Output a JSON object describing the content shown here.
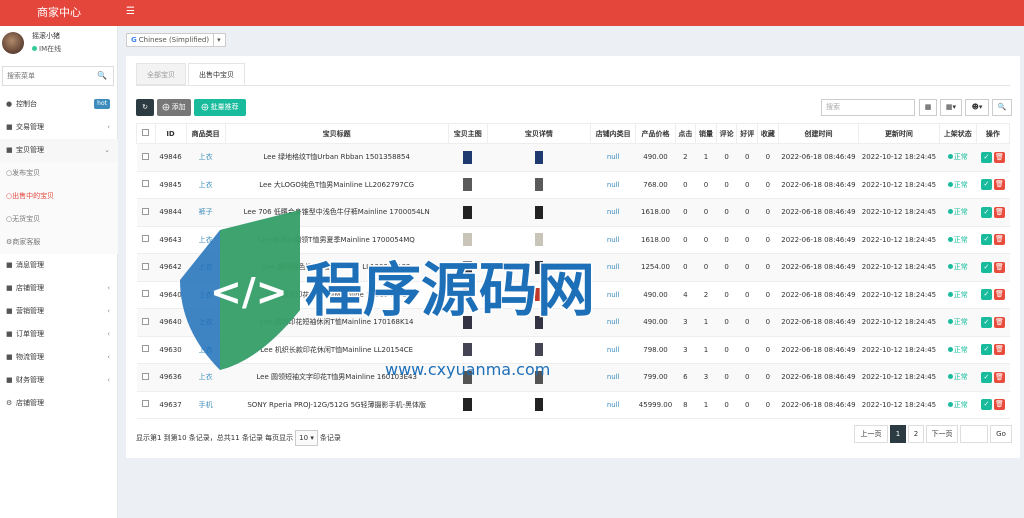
{
  "header": {
    "brand": "商家中心",
    "menu_icon": "hamburger-icon"
  },
  "user": {
    "name": "摇滚小猪",
    "status": "IM在线"
  },
  "sidebar": {
    "search_placeholder": "搜索菜单",
    "items": [
      {
        "label": "控制台",
        "icon": "dashboard-icon",
        "badge": "hot"
      },
      {
        "label": "交易管理",
        "icon": "transaction-icon"
      },
      {
        "label": "宝贝管理",
        "icon": "product-icon"
      },
      {
        "label": "发布宝贝",
        "icon": "circle-icon"
      },
      {
        "label": "出售中的宝贝",
        "icon": "circle-icon"
      },
      {
        "label": "无货宝贝",
        "icon": "circle-icon"
      },
      {
        "label": "商家客服",
        "icon": "gear-icon"
      },
      {
        "label": "消息管理",
        "icon": "message-icon"
      },
      {
        "label": "店铺管理",
        "icon": "store-icon"
      },
      {
        "label": "营销管理",
        "icon": "marketing-icon"
      },
      {
        "label": "订单管理",
        "icon": "order-icon"
      },
      {
        "label": "物流管理",
        "icon": "logistics-icon"
      },
      {
        "label": "财务管理",
        "icon": "finance-icon"
      },
      {
        "label": "店铺管理",
        "icon": "gear-icon"
      }
    ]
  },
  "language": {
    "selected": "Chinese (Simplified)"
  },
  "tabs": [
    {
      "label": "全部宝贝"
    },
    {
      "label": "出售中宝贝"
    }
  ],
  "toolbar": {
    "add": "添加",
    "export": "批量推荐",
    "search_placeholder": "搜索"
  },
  "table": {
    "headers": [
      "ID",
      "商品类目",
      "宝贝标题",
      "宝贝主图",
      "宝贝详情",
      "店铺内类目",
      "产品价格",
      "点击",
      "销量",
      "评论",
      "好评",
      "收藏",
      "创建时间",
      "更新时间",
      "上架状态",
      "操作"
    ],
    "rows": [
      {
        "id": "49846",
        "cat": "上衣",
        "title": "Lee 绿地格纹T恤Urban Rbban 1501358854",
        "shop_cat": "null",
        "price": "490.00",
        "clicks": "2",
        "sales": "1",
        "comments": "0",
        "good": "0",
        "fav": "0",
        "created": "2022-06-18 08:46:49",
        "updated": "2022-10-12 18:24:45",
        "status": "正常"
      },
      {
        "id": "49845",
        "cat": "上衣",
        "title": "Lee 大LOGO纯色T恤男Mainline LL2062797CG",
        "shop_cat": "null",
        "price": "768.00",
        "clicks": "0",
        "sales": "0",
        "comments": "0",
        "good": "0",
        "fav": "0",
        "created": "2022-06-18 08:46:49",
        "updated": "2022-10-12 18:24:45",
        "status": "正常"
      },
      {
        "id": "49844",
        "cat": "裤子",
        "title": "Lee 706 低腰合身锥型中浅色牛仔裤Mainline 1700054LN",
        "shop_cat": "null",
        "price": "1618.00",
        "clicks": "0",
        "sales": "0",
        "comments": "0",
        "good": "0",
        "fav": "0",
        "created": "2022-06-18 08:46:49",
        "updated": "2022-10-12 18:24:45",
        "status": "正常"
      },
      {
        "id": "49643",
        "cat": "上衣",
        "title": "Lee 休闲小翻领T恤男夏季Mainline 1700054MQ",
        "shop_cat": "null",
        "price": "1618.00",
        "clicks": "0",
        "sales": "0",
        "comments": "0",
        "good": "0",
        "fav": "0",
        "created": "2022-06-18 08:46:49",
        "updated": "2022-10-12 18:24:45",
        "status": "正常"
      },
      {
        "id": "49642",
        "cat": "上衣",
        "title": "Lee 圆领纯色短袖T恤Mainline LL130303A32",
        "shop_cat": "null",
        "price": "1254.00",
        "clicks": "0",
        "sales": "0",
        "comments": "0",
        "good": "0",
        "fav": "0",
        "created": "2022-06-18 08:46:49",
        "updated": "2022-10-12 18:24:45",
        "status": "正常"
      },
      {
        "id": "49640",
        "cat": "上衣",
        "title": "Lee 圆领印花休闲T恤Mainline 170154ACE",
        "shop_cat": "null",
        "price": "490.00",
        "clicks": "4",
        "sales": "2",
        "comments": "0",
        "good": "0",
        "fav": "0",
        "created": "2022-06-18 08:46:49",
        "updated": "2022-10-12 18:24:45",
        "status": "正常"
      },
      {
        "id": "49640",
        "cat": "上衣",
        "title": "Lee 圆领印花短袖休闲T恤Mainline 170168K14",
        "shop_cat": "null",
        "price": "490.00",
        "clicks": "3",
        "sales": "1",
        "comments": "0",
        "good": "0",
        "fav": "0",
        "created": "2022-06-18 08:46:49",
        "updated": "2022-10-12 18:24:45",
        "status": "正常"
      },
      {
        "id": "49630",
        "cat": "上衣",
        "title": "Lee 机织长款印花休闲T恤Mainline LL20154CE",
        "shop_cat": "null",
        "price": "798.00",
        "clicks": "3",
        "sales": "1",
        "comments": "0",
        "good": "0",
        "fav": "0",
        "created": "2022-06-18 08:46:49",
        "updated": "2022-10-12 18:24:45",
        "status": "正常"
      },
      {
        "id": "49636",
        "cat": "上衣",
        "title": "Lee 圆领短袖文字印花T恤男Mainline 160103E43",
        "shop_cat": "null",
        "price": "799.00",
        "clicks": "6",
        "sales": "3",
        "comments": "0",
        "good": "0",
        "fav": "0",
        "created": "2022-06-18 08:46:49",
        "updated": "2022-10-12 18:24:45",
        "status": "正常"
      },
      {
        "id": "49637",
        "cat": "手机",
        "title": "SONY Rperia PROJ-12G/512G 5G轻薄摄影手机-黑体版",
        "shop_cat": "null",
        "price": "45999.00",
        "clicks": "8",
        "sales": "1",
        "comments": "0",
        "good": "0",
        "fav": "0",
        "created": "2022-06-18 08:46:49",
        "updated": "2022-10-12 18:24:45",
        "status": "正常"
      }
    ]
  },
  "footer": {
    "info_prefix": "显示第1 到第10 条记录，总共11 条记录 每页显示",
    "page_size": "10",
    "info_suffix": "条记录",
    "prev": "上一页",
    "pages": [
      "1",
      "2"
    ],
    "next": "下一页",
    "go": "Go"
  },
  "watermark": {
    "brand": "程序源码网",
    "url": "www.cxyuanma.com"
  }
}
